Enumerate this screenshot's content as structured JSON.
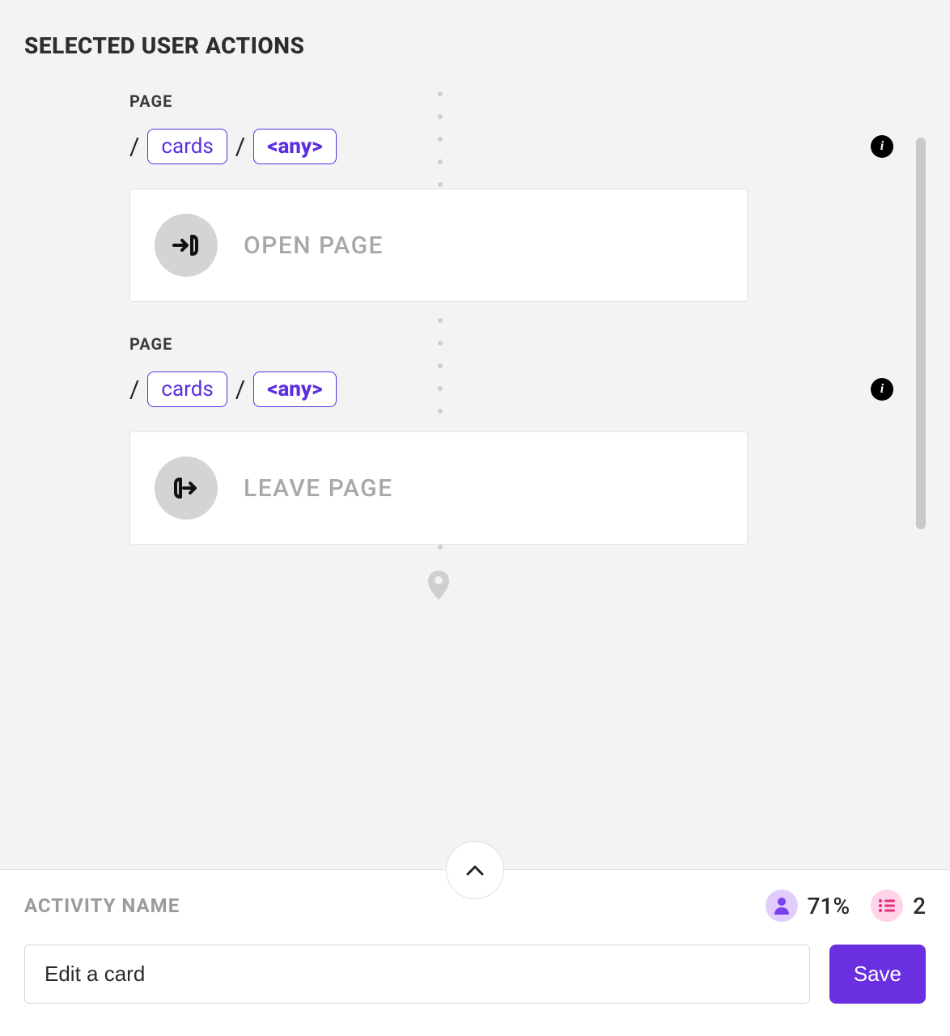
{
  "section_title": "SELECTED USER ACTIONS",
  "actions": [
    {
      "label": "PAGE",
      "path_segments": [
        "cards",
        "<any>"
      ],
      "action_label": "OPEN PAGE",
      "icon": "enter-icon"
    },
    {
      "label": "PAGE",
      "path_segments": [
        "cards",
        "<any>"
      ],
      "action_label": "LEAVE PAGE",
      "icon": "exit-icon"
    }
  ],
  "bottom": {
    "field_label": "ACTIVITY NAME",
    "name_value": "Edit a card",
    "save_label": "Save",
    "stats": {
      "users_pct": "71%",
      "steps_count": "2"
    }
  },
  "colors": {
    "accent": "#6a2fe0",
    "segment_border": "#5b2fe0",
    "muted_text": "#a8a8a8"
  }
}
